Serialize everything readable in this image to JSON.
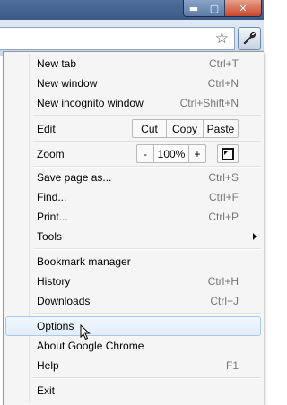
{
  "window_controls": {
    "minimize": "▬",
    "maximize": "▢",
    "close": "✕"
  },
  "menu": {
    "new_tab": {
      "label": "New tab",
      "shortcut": "Ctrl+T"
    },
    "new_window": {
      "label": "New window",
      "shortcut": "Ctrl+N"
    },
    "new_incognito": {
      "label": "New incognito window",
      "shortcut": "Ctrl+Shift+N"
    },
    "edit": {
      "label": "Edit",
      "cut": "Cut",
      "copy": "Copy",
      "paste": "Paste"
    },
    "zoom": {
      "label": "Zoom",
      "minus": "-",
      "value": "100%",
      "plus": "+"
    },
    "save_page": {
      "label": "Save page as...",
      "shortcut": "Ctrl+S"
    },
    "find": {
      "label": "Find...",
      "shortcut": "Ctrl+F"
    },
    "print": {
      "label": "Print...",
      "shortcut": "Ctrl+P"
    },
    "tools": {
      "label": "Tools"
    },
    "bookmark_manager": {
      "label": "Bookmark manager"
    },
    "history": {
      "label": "History",
      "shortcut": "Ctrl+H"
    },
    "downloads": {
      "label": "Downloads",
      "shortcut": "Ctrl+J"
    },
    "options": {
      "label": "Options"
    },
    "about": {
      "label": "About Google Chrome"
    },
    "help": {
      "label": "Help",
      "shortcut": "F1"
    },
    "exit": {
      "label": "Exit"
    }
  },
  "colors": {
    "hover_bg": "#e2eefb",
    "hover_border": "#a8c8ee",
    "titlebar": "#3c5a86"
  },
  "icons": {
    "star": "bookmark-star-icon",
    "wrench": "wrench-icon",
    "fullscreen": "fullscreen-icon",
    "submenu": "submenu-arrow-icon",
    "cursor": "mouse-pointer-icon"
  }
}
